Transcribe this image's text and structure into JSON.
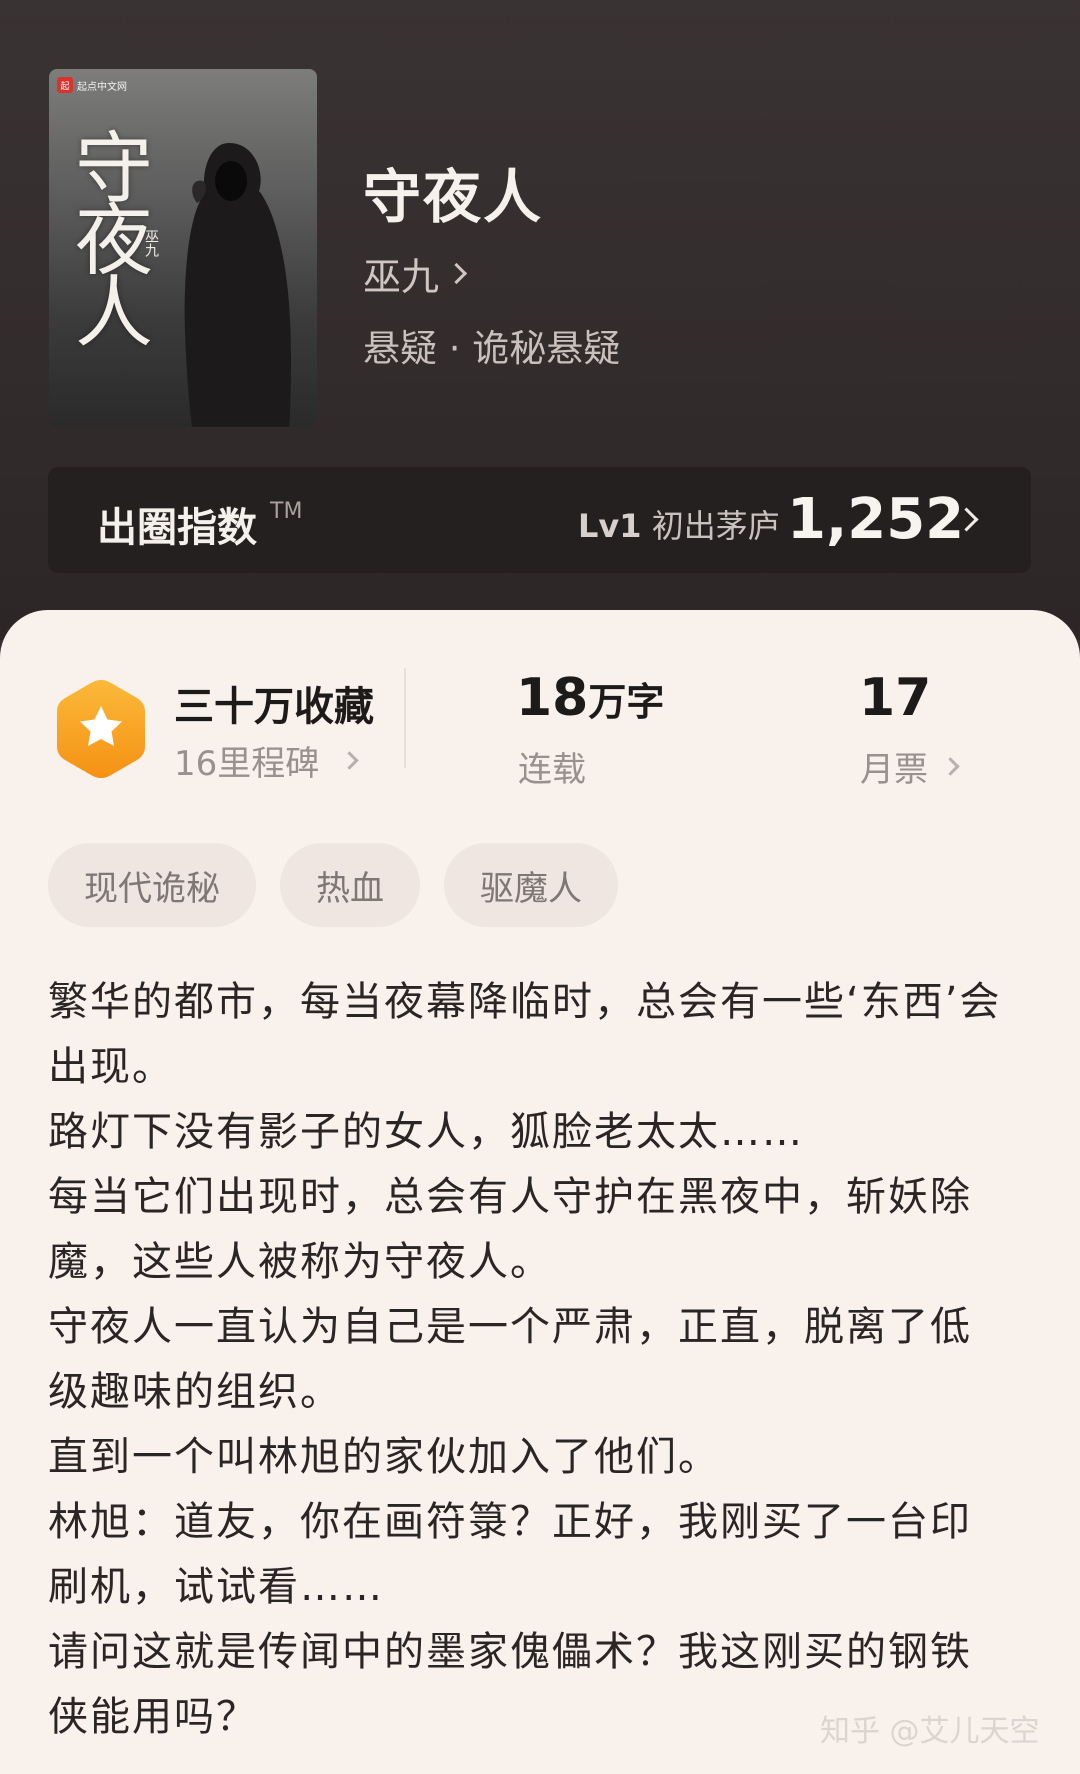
{
  "book": {
    "title": "守夜人",
    "author": "巫九",
    "genre": "悬疑 · 诡秘悬疑",
    "cover": {
      "publisher": "起点中文网",
      "title_chars": "守夜人",
      "author": "巫九"
    }
  },
  "index": {
    "label": "出圈指数",
    "tm": "TM",
    "level": "Lv1",
    "level_name": "初出茅庐",
    "score": "1,252"
  },
  "stats": {
    "collect_title": "三十万收藏",
    "collect_sub": "16里程碑",
    "words_num": "18",
    "words_unit": "万字",
    "words_sub": "连载",
    "tickets_num": "17",
    "tickets_sub": "月票"
  },
  "tags": [
    "现代诡秘",
    "热血",
    "驱魔人"
  ],
  "synopsis": [
    "繁华的都市，每当夜幕降临时，总会有一些‘东西’会出现。",
    "路灯下没有影子的女人，狐脸老太太……",
    "每当它们出现时，总会有人守护在黑夜中，斩妖除魔，这些人被称为守夜人。",
    "守夜人一直认为自己是一个严肃，正直，脱离了低级趣味的组织。",
    "直到一个叫林旭的家伙加入了他们。",
    "林旭：道友，你在画符箓？正好，我刚买了一台印刷机，试试看……",
    "请问这就是传闻中的墨家傀儡术？我这刚买的钢铁侠能用吗？"
  ],
  "watermark": "知乎 @艾儿天空",
  "colors": {
    "hero_bg": "#332c2c",
    "panel_bg": "#f8f1ec",
    "badge_orange": "#f7a21b"
  }
}
